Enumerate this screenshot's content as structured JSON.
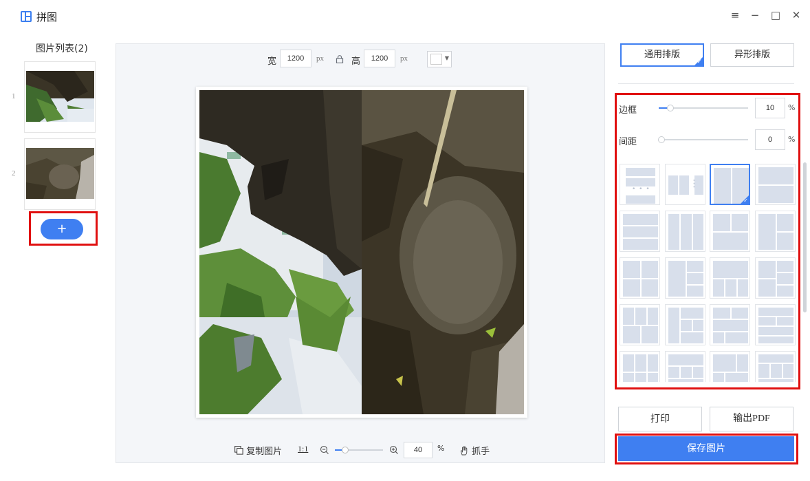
{
  "app": {
    "title": "拼图"
  },
  "window": {
    "menu_icon": "≡",
    "minimize_icon": "−",
    "maximize_icon": "□",
    "close_icon": "✕"
  },
  "image_list": {
    "title": "图片列表(2)",
    "items": [
      {
        "index": "1",
        "description": "thumbnail-tree-leaves"
      },
      {
        "index": "2",
        "description": "thumbnail-water-rock"
      }
    ],
    "add_label": "+"
  },
  "canvas_toolbar": {
    "width_label": "宽",
    "width_value": "1200",
    "width_unit": "px",
    "height_label": "高",
    "height_value": "1200",
    "height_unit": "px",
    "background_color": "#ffffff"
  },
  "bottom_toolbar": {
    "copy_label": "复制图片",
    "ratio_label": "1:1",
    "zoom_value": "40",
    "zoom_fraction": 0.15,
    "zoom_unit": "%",
    "hand_label": "抓手"
  },
  "tabs": [
    {
      "label": "通用排版",
      "active": true
    },
    {
      "label": "异形排版",
      "active": false
    }
  ],
  "settings": {
    "border": {
      "label": "边框",
      "value": "10",
      "unit": "%",
      "fraction": 0.1
    },
    "spacing": {
      "label": "间距",
      "value": "0",
      "unit": "%",
      "fraction": 0.0
    }
  },
  "actions": {
    "print_label": "打印",
    "pdf_label": "输出PDF",
    "save_label": "保存图片"
  },
  "colors": {
    "accent": "#3f7ff1",
    "highlight": "#e01010",
    "layout_cell": "#d8dfeb"
  }
}
